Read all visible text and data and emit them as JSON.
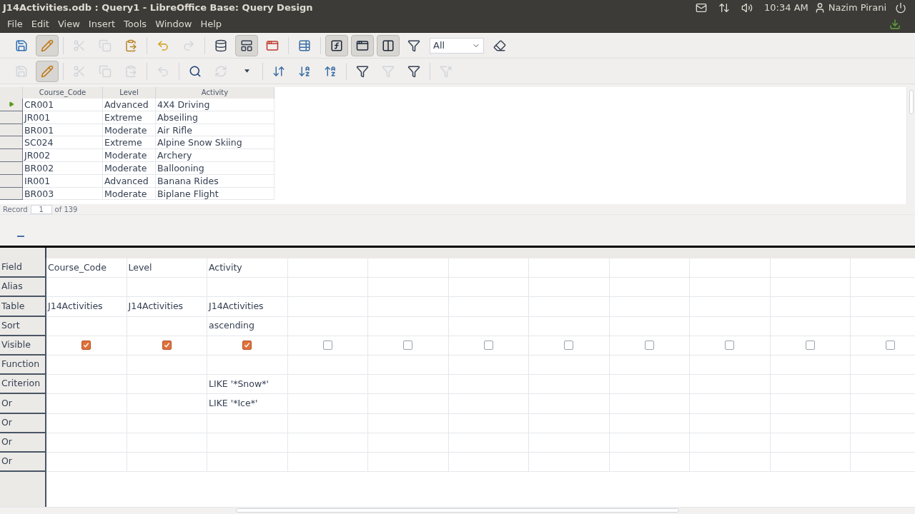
{
  "window": {
    "title": "J14Activities.odb : Query1 - LibreOffice Base: Query Design"
  },
  "top_panel": {
    "time": "10:34 AM",
    "user": "Nazim Pirani"
  },
  "menu": [
    "File",
    "Edit",
    "View",
    "Insert",
    "Tools",
    "Window",
    "Help"
  ],
  "toolbars": [
    [
      {
        "kind": "save",
        "disabled": false,
        "selected": false
      },
      {
        "kind": "edit",
        "disabled": false,
        "selected": true
      },
      {
        "kind": "sep"
      },
      {
        "kind": "cut",
        "disabled": true,
        "selected": false
      },
      {
        "kind": "copy",
        "disabled": true,
        "selected": false
      },
      {
        "kind": "paste",
        "disabled": false,
        "selected": false
      },
      {
        "kind": "sep"
      },
      {
        "kind": "undo",
        "disabled": false,
        "selected": false
      },
      {
        "kind": "redo",
        "disabled": true,
        "selected": false
      },
      {
        "kind": "sep"
      },
      {
        "kind": "database",
        "disabled": false,
        "selected": false
      },
      {
        "kind": "design",
        "disabled": false,
        "selected": true
      },
      {
        "kind": "window",
        "disabled": false,
        "selected": false
      },
      {
        "kind": "sep"
      },
      {
        "kind": "add_table",
        "disabled": false,
        "selected": false
      },
      {
        "kind": "sep"
      },
      {
        "kind": "functions",
        "disabled": false,
        "selected": true
      },
      {
        "kind": "table_name",
        "disabled": false,
        "selected": true
      },
      {
        "kind": "alias",
        "disabled": false,
        "selected": true
      },
      {
        "kind": "distinct",
        "disabled": false,
        "selected": false
      },
      {
        "kind": "combo",
        "value": "All"
      },
      {
        "kind": "clear",
        "disabled": false,
        "selected": false
      }
    ],
    [
      {
        "kind": "save",
        "disabled": true,
        "selected": false
      },
      {
        "kind": "edit",
        "disabled": false,
        "selected": true
      },
      {
        "kind": "sep"
      },
      {
        "kind": "cut",
        "disabled": true,
        "selected": false
      },
      {
        "kind": "copy",
        "disabled": true,
        "selected": false
      },
      {
        "kind": "paste",
        "disabled": true,
        "selected": false
      },
      {
        "kind": "sep"
      },
      {
        "kind": "undo",
        "disabled": true,
        "selected": false
      },
      {
        "kind": "sep"
      },
      {
        "kind": "find",
        "disabled": false,
        "selected": false
      },
      {
        "kind": "refresh",
        "disabled": true,
        "selected": false
      },
      {
        "kind": "dropdown",
        "disabled": false,
        "selected": false
      },
      {
        "kind": "sep"
      },
      {
        "kind": "sort",
        "disabled": false,
        "selected": false
      },
      {
        "kind": "sort_asc",
        "disabled": false,
        "selected": false
      },
      {
        "kind": "sort_desc",
        "disabled": false,
        "selected": false
      },
      {
        "kind": "sep"
      },
      {
        "kind": "autofilter",
        "disabled": false,
        "selected": false
      },
      {
        "kind": "apply_filter",
        "disabled": true,
        "selected": false
      },
      {
        "kind": "standard_filter",
        "disabled": false,
        "selected": false
      },
      {
        "kind": "sep"
      },
      {
        "kind": "remove_filter",
        "disabled": true,
        "selected": false
      }
    ]
  ],
  "preview": {
    "columns": [
      "Course_Code",
      "Level",
      "Activity"
    ],
    "rows": [
      {
        "cells": [
          "CR001",
          "Advanced",
          "4X4 Driving"
        ],
        "selected": true
      },
      {
        "cells": [
          "JR001",
          "Extreme",
          "Abseiling"
        ],
        "selected": false
      },
      {
        "cells": [
          "BR001",
          "Moderate",
          "Air Rifle"
        ],
        "selected": false
      },
      {
        "cells": [
          "SC024",
          "Extreme",
          "Alpine Snow Skiing"
        ],
        "selected": false
      },
      {
        "cells": [
          "JR002",
          "Moderate",
          "Archery"
        ],
        "selected": false
      },
      {
        "cells": [
          "BR002",
          "Moderate",
          "Ballooning"
        ],
        "selected": false
      },
      {
        "cells": [
          "IR001",
          "Advanced",
          "Banana Rides"
        ],
        "selected": false
      },
      {
        "cells": [
          "BR003",
          "Moderate",
          "Biplane Flight"
        ],
        "selected": false
      }
    ],
    "record": {
      "label": "Record",
      "value": "1",
      "total": "of 139"
    }
  },
  "design_grid": {
    "row_labels": [
      "Field",
      "Alias",
      "Table",
      "Sort",
      "Visible",
      "Function",
      "Criterion",
      "Or",
      "Or",
      "Or",
      "Or"
    ],
    "columns": [
      {
        "field": "Course_Code",
        "table": "J14Activities",
        "visible": true
      },
      {
        "field": "Level",
        "table": "J14Activities",
        "visible": true
      },
      {
        "field": "Activity",
        "table": "J14Activities",
        "sort": "ascending",
        "visible": true,
        "criterion": "LIKE '*Snow*'",
        "or": [
          "LIKE '*Ice*'"
        ]
      },
      {
        "visible": false
      },
      {
        "visible": false
      },
      {
        "visible": false
      },
      {
        "visible": false
      },
      {
        "visible": false
      },
      {
        "visible": false
      },
      {
        "visible": false
      },
      {
        "visible": false
      }
    ]
  }
}
